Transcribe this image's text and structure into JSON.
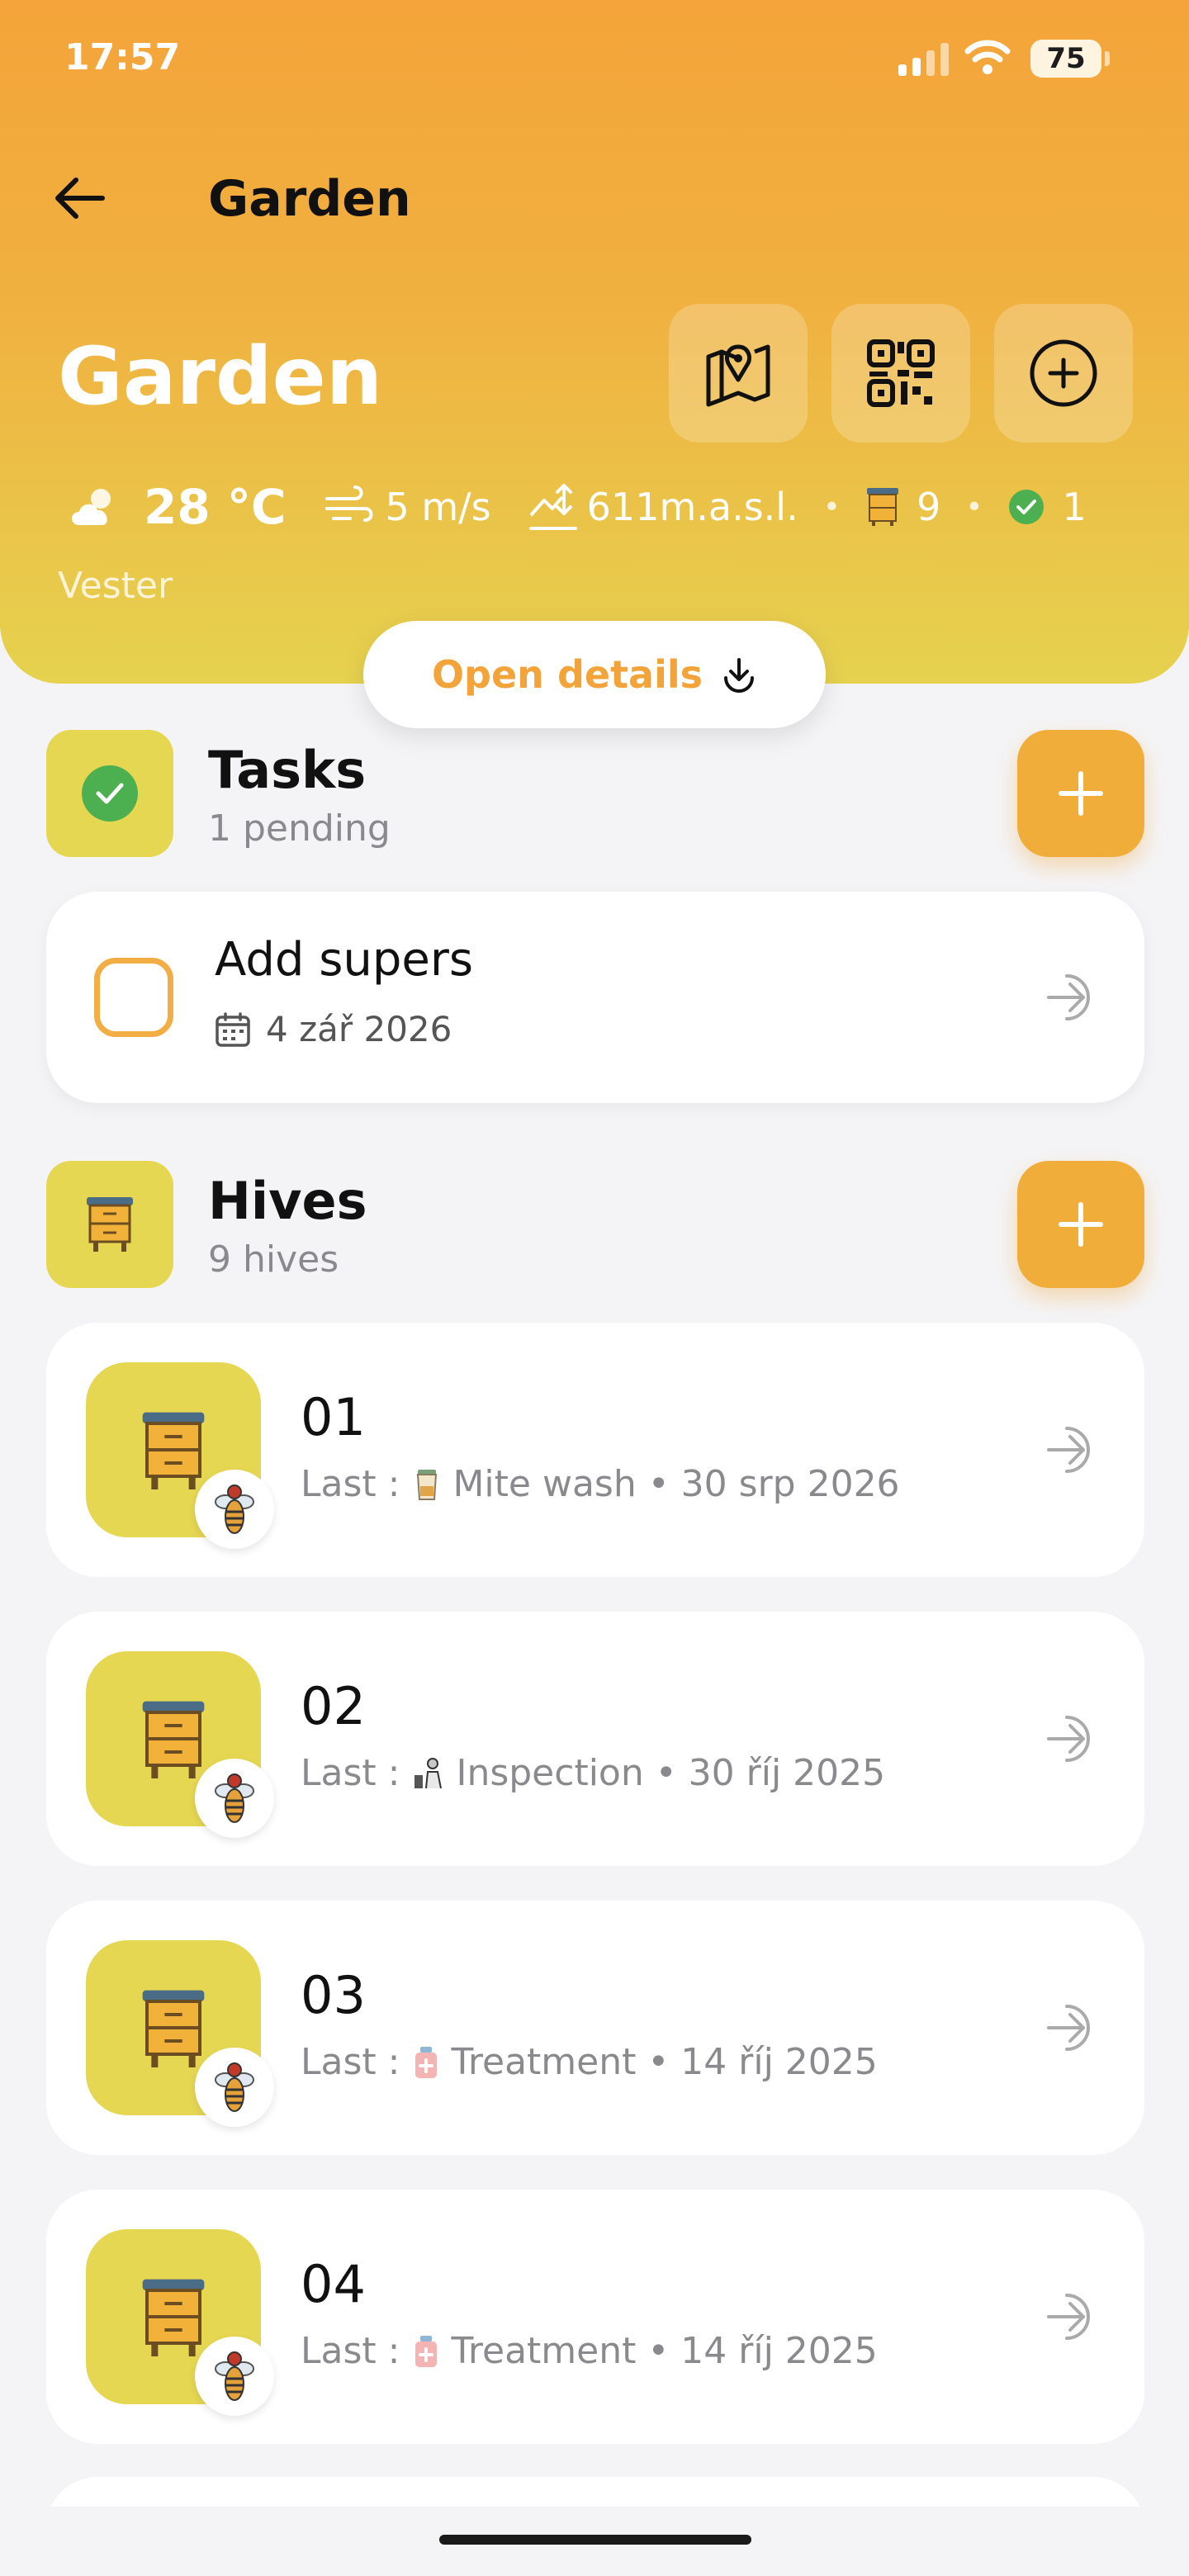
{
  "status_bar": {
    "time": "17:57",
    "battery": "75"
  },
  "nav": {
    "title": "Garden"
  },
  "apiary": {
    "name": "Garden",
    "temperature": "28 °C",
    "wind": "5 m/s",
    "altitude": "611m.a.s.l.",
    "hive_count": "9",
    "tasks_done": "1",
    "location": "Vester"
  },
  "open_details": {
    "label": "Open details"
  },
  "tasks": {
    "title": "Tasks",
    "subtitle": "1 pending",
    "items": [
      {
        "title": "Add supers",
        "date": "4 zář 2026"
      }
    ]
  },
  "hives": {
    "title": "Hives",
    "subtitle": "9 hives",
    "last_label": "Last :",
    "items": [
      {
        "name": "01",
        "activity": "Mite wash",
        "date": "30 srp 2026",
        "activity_icon": "jar-icon"
      },
      {
        "name": "02",
        "activity": "Inspection",
        "date": "30 říj 2025",
        "activity_icon": "beekeeper-icon"
      },
      {
        "name": "03",
        "activity": "Treatment",
        "date": "14 říj 2025",
        "activity_icon": "medicine-bottle-icon"
      },
      {
        "name": "04",
        "activity": "Treatment",
        "date": "14 říj 2025",
        "activity_icon": "medicine-bottle-icon"
      }
    ]
  },
  "colors": {
    "accent_orange": "#f0ad39",
    "header_top": "#f4a43a",
    "header_bottom": "#e6d24f",
    "hive_tile": "#e6d753",
    "done_green": "#4caf50"
  }
}
